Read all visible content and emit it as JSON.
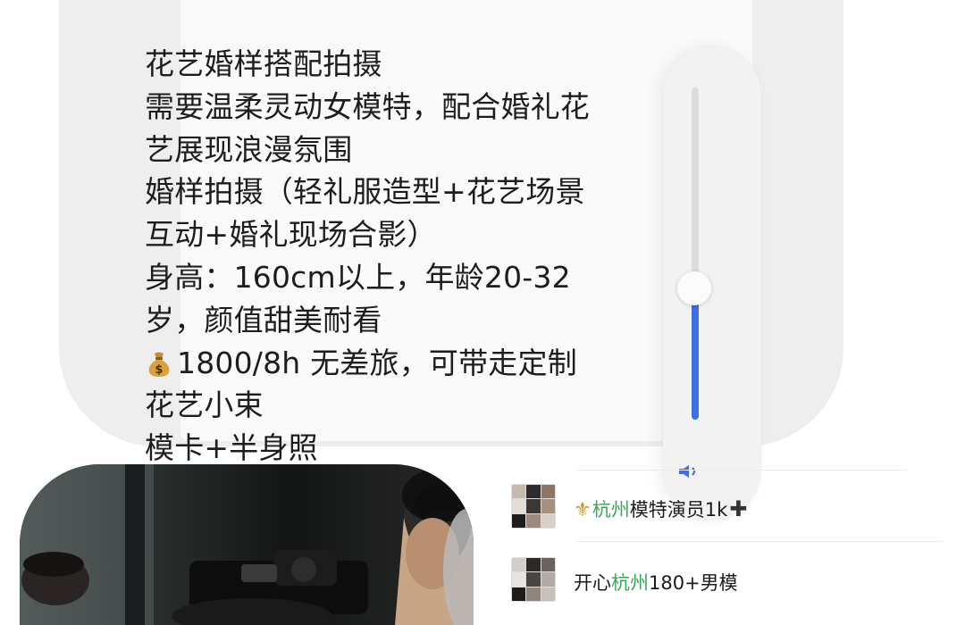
{
  "message": {
    "lines": [
      "花艺婚样搭配拍摄",
      "需要温柔灵动女模特，配合婚礼花",
      "艺展现浪漫氛围",
      "婚样拍摄（轻礼服造型+花艺场景",
      "互动+婚礼现场合影）",
      "身高：160cm以上，年龄20-32",
      "岁，颜值甜美耐看",
      "1800/8h 无差旅，可带走定制",
      "花艺小束",
      "模卡+半身照"
    ],
    "money_icon": "money-bag-icon"
  },
  "volume_slider": {
    "level_percent": 39,
    "icon": "speaker-icon",
    "accent_color": "#3d6fe0"
  },
  "chat_list": [
    {
      "icon_prefix": "⚜",
      "highlight": "杭州",
      "rest": "模特演员1k",
      "suffix": "✚",
      "highlight_color": "#3aa853"
    },
    {
      "prefix": "开心",
      "highlight": "杭州",
      "rest": "180+男模"
    }
  ]
}
